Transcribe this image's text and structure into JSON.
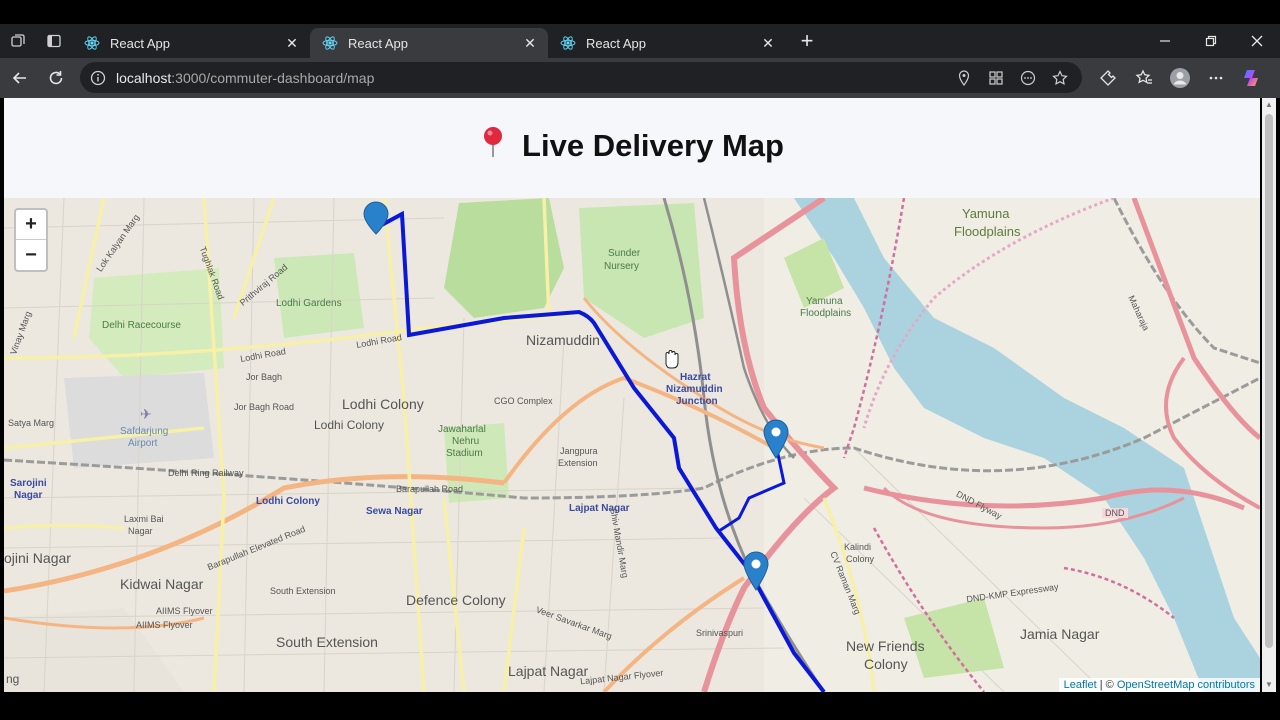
{
  "browser": {
    "tabs": [
      {
        "title": "React App",
        "active": false
      },
      {
        "title": "React App",
        "active": true
      },
      {
        "title": "React App",
        "active": false
      }
    ],
    "address": {
      "host": "localhost",
      "path": ":3000/commuter-dashboard/map"
    }
  },
  "page": {
    "title": "Live Delivery Map",
    "title_icon": "📍"
  },
  "map": {
    "zoom_in": "+",
    "zoom_out": "−",
    "attribution_leaflet": "Leaflet",
    "attribution_sep": " | © ",
    "attribution_osm": "OpenStreetMap contributors",
    "labels": {
      "nizamuddin": "Nizamuddin",
      "lodhi_colony": "Lodhi Colony",
      "lodhi_colony_2": "Lodhi Colony",
      "lodhi_colony_3": "Lodhi Colony",
      "kidwai_nagar": "Kidwai Nagar",
      "defence_colony": "Defence Colony",
      "south_extension": "South Extension",
      "south_extension_2": "South Extension",
      "lajpat_nagar": "Lajpat Nagar",
      "lajpat_nagar_2": "Lajpat Nagar",
      "new_friends": "New Friends",
      "colony": "Colony",
      "jamia_nagar": "Jamia Nagar",
      "sewa_nagar": "Sewa Nagar",
      "delhi_racecourse": "Delhi Racecourse",
      "lodhi_gardens": "Lodhi Gardens",
      "safdarjung": "Safdarjung",
      "airport": "Airport",
      "jor_bagh": "Jor Bagh",
      "jor_bagh_road": "Jor Bagh Road",
      "lodhi_road": "Lodhi Road",
      "lodhi_road_2": "Lodhi Road",
      "sunder_nursery": "Sunder",
      "nursery": "Nursery",
      "hazrat": "Hazrat",
      "nizamuddin_junction": "Nizamuddin",
      "junction": "Junction",
      "cgo_complex": "CGO Complex",
      "jawaharlal": "Jawaharlal",
      "nehru": "Nehru",
      "stadium": "Stadium",
      "jangpura": "Jangpura",
      "extension": "Extension",
      "barapullah_road": "Barapullah Road",
      "barapullah_elevated": "Barapullah Elevated Road",
      "sarojini": "Sarojini",
      "nagar": "Nagar",
      "ojini_nagar": "ojini Nagar",
      "laxmi_bai": "Laxmi Bai",
      "nagar_2": "Nagar",
      "aiims_flyover": "AIIMS Flyover",
      "aiims_flyover_2": "AIIMS Flyover",
      "yamuna": "Yamuna",
      "floodplains": "Floodplains",
      "dnd": "DND",
      "dnd_flyway": "DND Flyway",
      "dnd_kmp": "DND-KMP Expressway",
      "satya_marg": "Satya Marg",
      "delhi_ring_railway": "Delhi Ring Railway",
      "kalindi": "Kalindi",
      "colony_2": "Colony",
      "cv_raman_marg": "CV Raman Marg",
      "shiv_mandir_marg": "Shiv Mandir Marg",
      "veer_savarkar_marg": "Veer Savarkar Marg",
      "srinivaspuri": "Srinivaspuri",
      "lajpat_nagar_flyover": "Lajpat Nagar Flyover",
      "ng": "ng",
      "lok_kalyan_marg": "Lok Kalyan Marg",
      "tughlak_road": "Tughlak Road",
      "prithviraj_road": "Prithviraj Road",
      "vinay_marg": "Vinay Marg",
      "maharaja": "Maharaja",
      "yamuna_2": "Yamuna",
      "floodplains_2": "Floodplains"
    }
  }
}
